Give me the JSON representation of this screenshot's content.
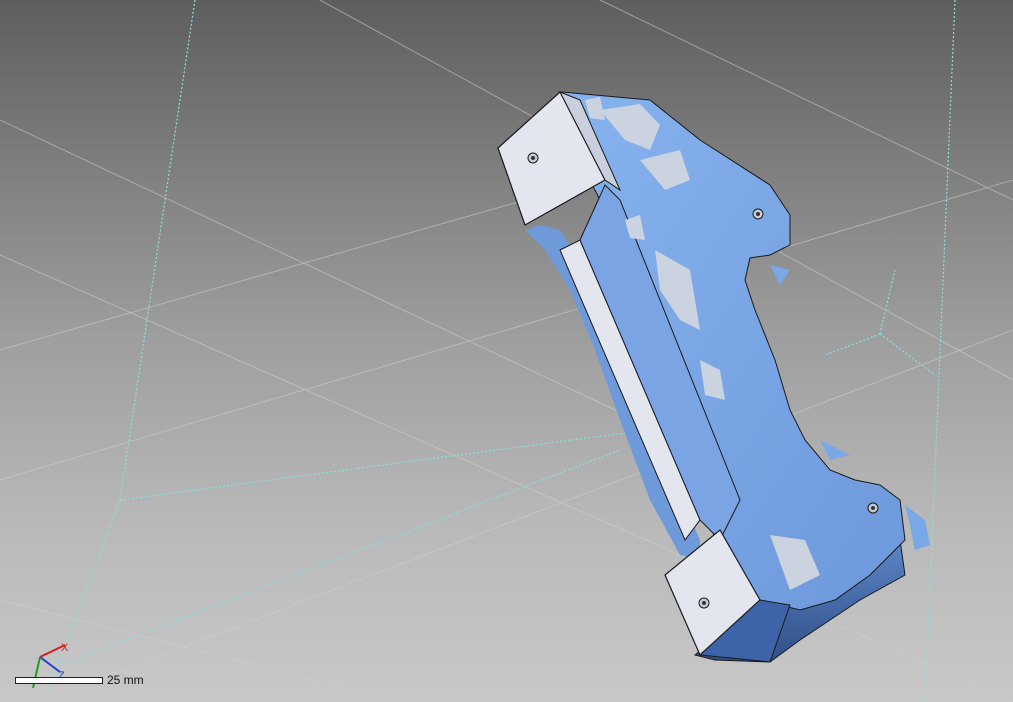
{
  "viewport": {
    "background_top": "#5e5e5e",
    "background_bottom": "#c8c8c8",
    "grid_color": "#d0d0d0",
    "axis_line_color": "#7fdcdc"
  },
  "model": {
    "scan_color": "#7aa7e6",
    "cad_color": "#e3e6ef",
    "edge_color": "#1a1a1a"
  },
  "axis_triad": {
    "x_label": "X",
    "z_label": "Z",
    "x_color": "#d42020",
    "y_color": "#20a020",
    "z_color": "#2040d0"
  },
  "scale_bar": {
    "label": "25 mm"
  }
}
